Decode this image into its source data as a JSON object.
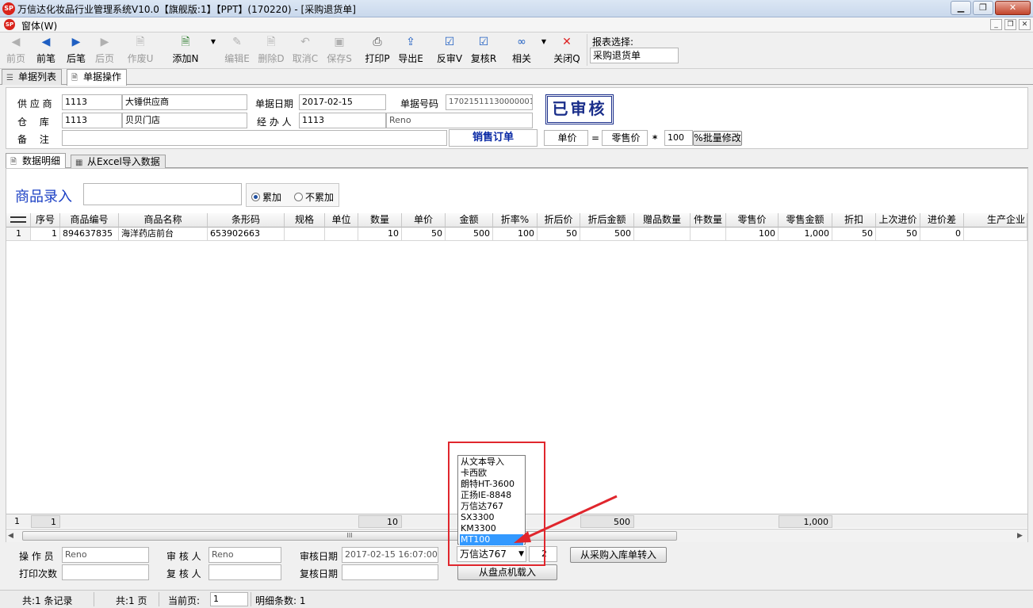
{
  "window": {
    "title": "万信达化妆品行业管理系统V10.0【旗舰版:1】【PPT】(170220) - [采购退货单]",
    "logo_text": "SP"
  },
  "menu": {
    "window_label": "窗体(W)"
  },
  "toolbar": {
    "first": "前页",
    "prev": "前笔",
    "next": "后笔",
    "last": "后页",
    "void": "作废U",
    "add": "添加N",
    "edit": "编辑E",
    "delete": "删除D",
    "cancel": "取消C",
    "save": "保存S",
    "print": "打印P",
    "export": "导出E",
    "unaudit": "反审V",
    "review": "复核R",
    "related": "相关",
    "close": "关闭Q",
    "report_label": "报表选择:",
    "report_value": "采购退货单"
  },
  "tabs": {
    "list": "单据列表",
    "operation": "单据操作"
  },
  "header": {
    "supplier_label": "供 应 商",
    "supplier_code": "1113",
    "supplier_name": "大锤供应商",
    "date_label": "单据日期",
    "date_value": "2017-02-15",
    "number_label": "单据号码",
    "number_value": "17021511130000001",
    "warehouse_label": "仓　 库",
    "warehouse_code": "1113",
    "warehouse_name": "贝贝门店",
    "handler_label": "经 办 人",
    "handler_code": "1113",
    "handler_name": "Reno",
    "remark_label": "备　 注",
    "remark_value": "",
    "status_stamp": "已审核",
    "sales_order": "销售订单",
    "price_label": "单价",
    "equals": "=",
    "price_source": "零售价",
    "times": "*",
    "multiplier": "100",
    "batch_button": "%批量修改"
  },
  "subtabs": {
    "detail": "数据明细",
    "excel": "从Excel导入数据"
  },
  "entry": {
    "label": "商品录入",
    "accumulate": "累加",
    "no_accumulate": "不累加"
  },
  "grid": {
    "columns": [
      "序号",
      "商品编号",
      "商品名称",
      "条形码",
      "规格",
      "单位",
      "数量",
      "单价",
      "金额",
      "折率%",
      "折后价",
      "折后金额",
      "赠品数量",
      "件数量",
      "零售价",
      "零售金额",
      "折扣",
      "上次进价",
      "进价差",
      "生产企业"
    ],
    "rows": [
      {
        "row_no": "1",
        "seq": "1",
        "code": "894637835",
        "name": "海洋药店前台",
        "barcode": "653902663",
        "spec": "",
        "unit": "",
        "qty": "10",
        "price": "50",
        "amount": "500",
        "rate": "100",
        "disc_price": "50",
        "disc_amount": "500",
        "gift_qty": "",
        "pieces": "",
        "retail_price": "100",
        "retail_amount": "1,000",
        "discount": "50",
        "last_price": "50",
        "price_diff": "0",
        "maker": ""
      }
    ],
    "footer": {
      "rownum": "1",
      "seq": "1",
      "qty": "10",
      "disc_amount": "500",
      "retail_amount": "1,000"
    },
    "scroll_grip": "III"
  },
  "dropdown": {
    "items": [
      "从文本导入",
      "卡西欧",
      "朗特HT-3600",
      "正扬IE-8848",
      "万信达767",
      "SX3300",
      "KM3300",
      "MT100"
    ],
    "selected_index": 7,
    "current": "万信达767",
    "count": "2"
  },
  "bottom": {
    "operator_label": "操 作 员",
    "operator_value": "Reno",
    "auditor_label": "审 核 人",
    "auditor_value": "Reno",
    "audit_date_label": "审核日期",
    "audit_date_value": "2017-02-15 16:07:00",
    "print_count_label": "打印次数",
    "print_count_value": "",
    "reviewer_label": "复 核 人",
    "reviewer_value": "",
    "review_date_label": "复核日期",
    "review_date_value": "",
    "from_purchase_button": "从采购入库单转入",
    "from_inventory_button": "从盘点机载入"
  },
  "status": {
    "records": "共:1 条记录",
    "pages": "共:1 页",
    "current_page_label": "当前页:",
    "current_page": "1",
    "detail_count": "明细条数: 1"
  },
  "colors": {
    "accent_blue": "#1a3fc4",
    "stamp": "#1a2e8a",
    "highlight_red": "#e0262d",
    "selection": "#3399ff"
  }
}
